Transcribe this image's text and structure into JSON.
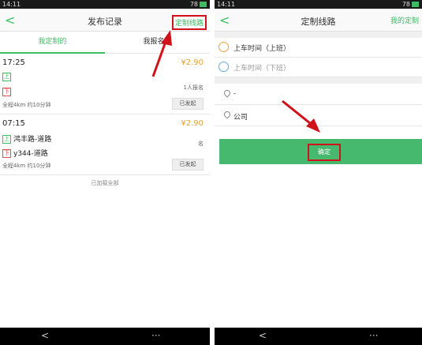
{
  "left_screen": {
    "status": {
      "time": "14:11",
      "right": "78"
    },
    "navbar": {
      "back_icon": "chevron-left",
      "title": "发布记录",
      "action": "定制线路"
    },
    "tabs": [
      "我定制的",
      "我报名的"
    ],
    "trips": [
      {
        "time": "17:25",
        "price": "¥2.90",
        "up_tag": "上",
        "up_place": "",
        "down_tag": "下",
        "down_place": "",
        "enrolled": "1人报名",
        "info": "全程4km   约10分钟",
        "status": "已发起"
      },
      {
        "time": "07:15",
        "price": "¥2.90",
        "up_tag": "上",
        "up_place": "鸿丰路-道路",
        "down_tag": "下",
        "down_place": "y344-道路",
        "enrolled": "名",
        "info": "全程4km   约10分钟",
        "status": "已发起"
      }
    ],
    "loaded_text": "已加载全部"
  },
  "right_screen": {
    "status": {
      "time": "14:11",
      "right": "78"
    },
    "navbar": {
      "back_icon": "chevron-left",
      "title": "定制线路",
      "action": "我的定制"
    },
    "boarding_time": "上车时间（上班）",
    "return_time": "上车时间（下班）",
    "start_location": "-",
    "end_location": "公司",
    "confirm_label": "确定"
  },
  "colors": {
    "accent": "#3cbd64",
    "price": "#e8a33a",
    "highlight": "#d0121b"
  }
}
